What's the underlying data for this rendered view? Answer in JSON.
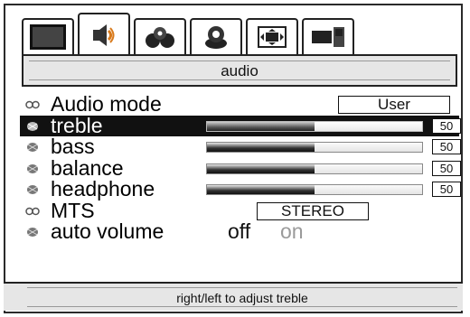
{
  "tabs": [
    {
      "icon": "picture-icon",
      "active": false
    },
    {
      "icon": "audio-icon",
      "active": true
    },
    {
      "icon": "setup-icon",
      "active": false
    },
    {
      "icon": "parental-icon",
      "active": false
    },
    {
      "icon": "screen-icon",
      "active": false
    },
    {
      "icon": "pip-icon",
      "active": false
    }
  ],
  "header": {
    "title": "audio"
  },
  "menu": {
    "audio_mode": {
      "label": "Audio mode",
      "value": "User"
    },
    "treble": {
      "label": "treble",
      "value": "50",
      "level": 0.5
    },
    "bass": {
      "label": "bass",
      "value": "50",
      "level": 0.5
    },
    "balance": {
      "label": "balance",
      "value": "50",
      "level": 0.5
    },
    "headphone": {
      "label": "headphone",
      "value": "50",
      "level": 0.5
    },
    "mts": {
      "label": "MTS",
      "value": "STEREO"
    },
    "auto_volume": {
      "label": "auto volume",
      "off": "off",
      "on": "on",
      "selected": "off"
    }
  },
  "footer": {
    "hint": "right/left to adjust treble"
  },
  "colors": {
    "selected_row": "#111111",
    "panel_band": "#e6e6e6",
    "disabled_text": "#9a9a9a"
  }
}
